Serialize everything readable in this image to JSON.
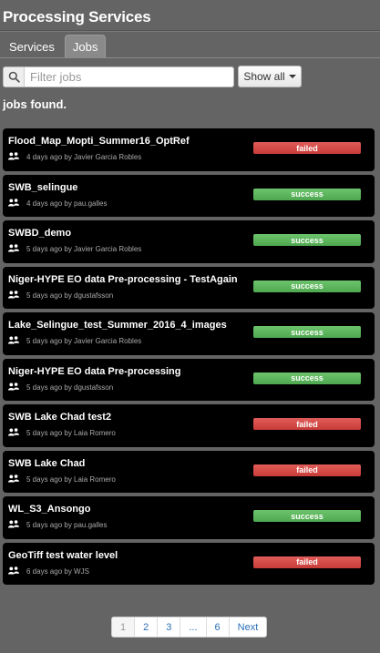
{
  "app": {
    "title": "Processing Services"
  },
  "tabs": [
    {
      "label": "Services",
      "active": false
    },
    {
      "label": "Jobs",
      "active": true
    }
  ],
  "filter": {
    "placeholder": "Filter jobs",
    "value": "",
    "show_button": "Show all"
  },
  "results_text": "jobs found.",
  "jobs": [
    {
      "name": "Flood_Map_Mopti_Summer16_OptRef",
      "meta": "4 days ago by Javier Garcia Robles",
      "status": "failed"
    },
    {
      "name": "SWB_selingue",
      "meta": "4 days ago by pau.galles",
      "status": "success"
    },
    {
      "name": "SWBD_demo",
      "meta": "5 days ago by Javier Garcia Robles",
      "status": "success"
    },
    {
      "name": "Niger-HYPE EO data Pre-processing - TestAgain",
      "meta": "5 days ago by dgustafsson",
      "status": "success"
    },
    {
      "name": "Lake_Selingue_test_Summer_2016_4_images",
      "meta": "5 days ago by Javier Garcia Robles",
      "status": "success"
    },
    {
      "name": "Niger-HYPE EO data Pre-processing",
      "meta": "5 days ago by dgustafsson",
      "status": "success"
    },
    {
      "name": "SWB Lake Chad test2",
      "meta": "5 days ago by Laia Romero",
      "status": "failed"
    },
    {
      "name": "SWB Lake Chad",
      "meta": "5 days ago by Laia Romero",
      "status": "failed"
    },
    {
      "name": "WL_S3_Ansongo",
      "meta": "5 days ago by pau.galles",
      "status": "success"
    },
    {
      "name": "GeoTiff test water level",
      "meta": "6 days ago by WJS",
      "status": "failed"
    }
  ],
  "pagination": [
    {
      "label": "1",
      "current": true
    },
    {
      "label": "2",
      "current": false
    },
    {
      "label": "3",
      "current": false
    },
    {
      "label": "...",
      "current": false
    },
    {
      "label": "6",
      "current": false
    },
    {
      "label": "Next",
      "current": false
    }
  ],
  "icons": {
    "search": "search-icon",
    "users": "users-icon",
    "caret": "caret-down-icon"
  }
}
